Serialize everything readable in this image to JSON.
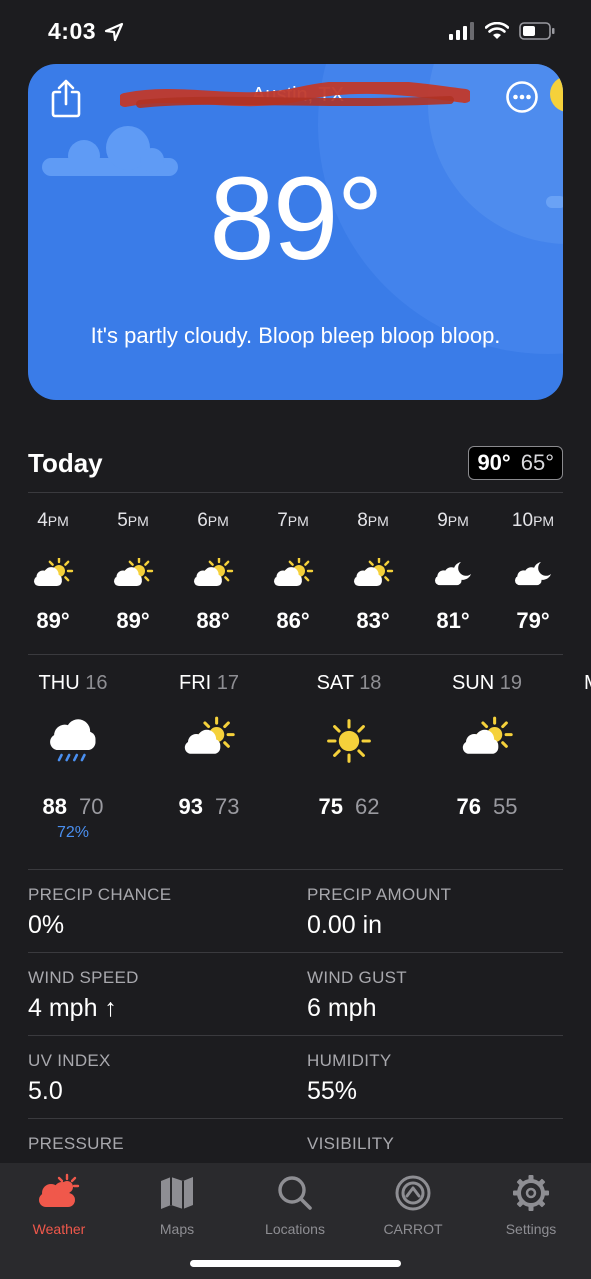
{
  "status_bar": {
    "time": "4:03"
  },
  "hero": {
    "city": "Austin, TX",
    "temperature": "89°",
    "description": "It's partly cloudy. Bloop bleep bloop bloop."
  },
  "today": {
    "label": "Today",
    "high": "90°",
    "low": "65°"
  },
  "hourly": [
    {
      "hour": "4",
      "ampm": "PM",
      "icon": "partly-cloudy-day-icon",
      "temp": "89°"
    },
    {
      "hour": "5",
      "ampm": "PM",
      "icon": "partly-cloudy-day-icon",
      "temp": "89°"
    },
    {
      "hour": "6",
      "ampm": "PM",
      "icon": "partly-cloudy-day-icon",
      "temp": "88°"
    },
    {
      "hour": "7",
      "ampm": "PM",
      "icon": "partly-cloudy-day-icon",
      "temp": "86°"
    },
    {
      "hour": "8",
      "ampm": "PM",
      "icon": "partly-cloudy-day-icon",
      "temp": "83°"
    },
    {
      "hour": "9",
      "ampm": "PM",
      "icon": "partly-cloudy-night-icon",
      "temp": "81°"
    },
    {
      "hour": "10",
      "ampm": "PM",
      "icon": "partly-cloudy-night-icon",
      "temp": "79°"
    }
  ],
  "daily": [
    {
      "day": "THU",
      "date": "16",
      "icon": "rain-icon",
      "high": "88",
      "low": "70",
      "precip": "72%"
    },
    {
      "day": "FRI",
      "date": "17",
      "icon": "partly-cloudy-day-icon",
      "high": "93",
      "low": "73",
      "precip": ""
    },
    {
      "day": "SAT",
      "date": "18",
      "icon": "sun-icon",
      "high": "75",
      "low": "62",
      "precip": ""
    },
    {
      "day": "SUN",
      "date": "19",
      "icon": "partly-cloudy-day-icon",
      "high": "76",
      "low": "55",
      "precip": ""
    }
  ],
  "daily_peek": "M",
  "details": {
    "precip_chance": {
      "label": "PRECIP CHANCE",
      "value": "0%"
    },
    "precip_amount": {
      "label": "PRECIP AMOUNT",
      "value": "0.00 in"
    },
    "wind_speed": {
      "label": "WIND SPEED",
      "value": "4 mph ↑"
    },
    "wind_gust": {
      "label": "WIND GUST",
      "value": "6 mph"
    },
    "uv_index": {
      "label": "UV INDEX",
      "value": "5.0"
    },
    "humidity": {
      "label": "HUMIDITY",
      "value": "55%"
    },
    "pressure": {
      "label": "PRESSURE",
      "value": ""
    },
    "visibility": {
      "label": "VISIBILITY",
      "value": ""
    }
  },
  "tabs": [
    {
      "label": "Weather",
      "icon": "weather-icon",
      "active": true
    },
    {
      "label": "Maps",
      "icon": "map-icon",
      "active": false
    },
    {
      "label": "Locations",
      "icon": "search-icon",
      "active": false
    },
    {
      "label": "CARROT",
      "icon": "carrot-icon",
      "active": false
    },
    {
      "label": "Settings",
      "icon": "gear-icon",
      "active": false
    }
  ],
  "colors": {
    "background": "#1c1c1f",
    "hero_blue": "#3a7ce8",
    "accent_red": "#f0584b",
    "precip_blue": "#4a8ff0",
    "sun_yellow": "#f5d13b"
  }
}
